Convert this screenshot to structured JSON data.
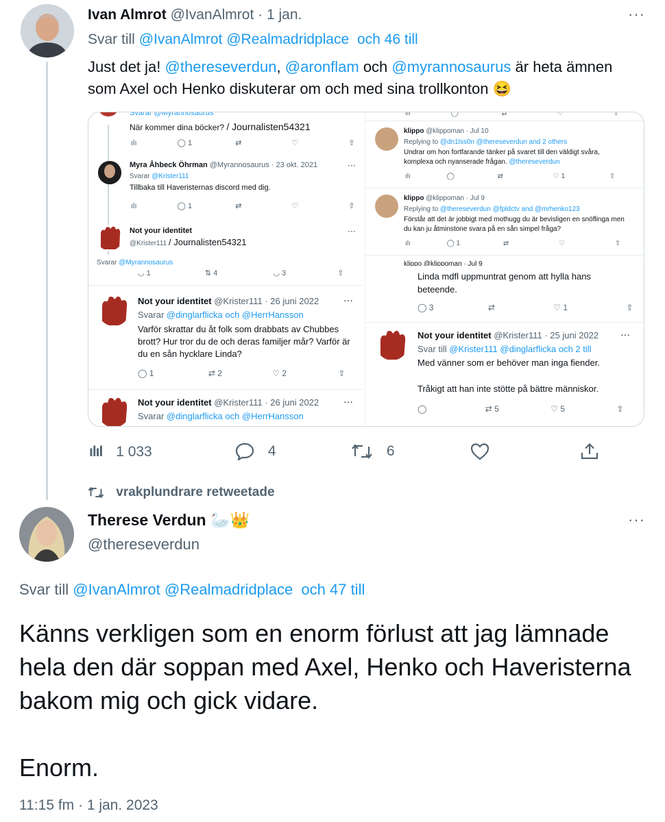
{
  "tweet1": {
    "name": "Ivan Almrot",
    "handle": "@IvanAlmrot",
    "dot": "·",
    "date": "1 jan.",
    "more": "···",
    "reply_prefix": "Svar till",
    "reply_to_1": "@IvanAlmrot",
    "reply_to_2": "@Realmadridplace",
    "reply_more": "och 46 till",
    "text_1": "Just det ja!",
    "mention_1": "@thereseverdun",
    "text_2": ",",
    "mention_2": "@aronflam",
    "text_3": "och",
    "mention_3": "@myrannosaurus",
    "text_4": "är heta ämnen som Axel och Henko diskuterar om och med sina trollkonton",
    "emoji": "😆",
    "stats": {
      "views": "1 033",
      "replies": "4",
      "retweets": "6"
    }
  },
  "embedded": {
    "left": {
      "top_reply": "Svarar @Myrannosaurus",
      "q1_text": "När kommer dina böcker?",
      "q1_tag": "/ Journalisten54321",
      "q1_reply_count": "1",
      "myra_name": "Myra Åhbeck Öhrman",
      "myra_handle": "@Myrannosaurus · 23 okt. 2021",
      "myra_reply_prefix": "Svarar",
      "myra_reply_to": "@Krister111",
      "myra_text": "Tillbaka till Haveristernas discord med dig.",
      "myra_reply_count": "1",
      "nyi_name": "Not your identitet",
      "nyi_handle": "@Krister111",
      "nyi_tag": "/ Journalisten54321",
      "svarar_label": "Svarar",
      "svarar_to": "@Myrannosaurus",
      "row_counts": [
        "1",
        "4",
        "3"
      ],
      "t2_name": "Not your identitet",
      "t2_meta": "@Krister111 · 26 juni 2022",
      "t2_reply_prefix": "Svarar",
      "t2_reply_to": "@dinglarflicka och @HerrHansson",
      "t2_text": "Varför skrattar du åt folk som drabbats av Chubbes brott? Hur tror du de och deras familjer mår? Varför är du en sån hycklare Linda?",
      "t2_counts": [
        "1",
        "2",
        "2"
      ],
      "t3_name": "Not your identitet",
      "t3_meta": "@Krister111 · 26 juni 2022",
      "t3_reply_prefix": "Svarar",
      "t3_reply_to": "@dinglarflicka och @HerrHansson"
    },
    "right": {
      "k1_name": "klippo",
      "k1_meta": "@klippoman · Jul 10",
      "k1_reply": "Replying to",
      "k1_reply_to": "@dn1lss0n @thereseverdun and 2 others",
      "k1_text_1": "Undrar om hon fortfarande tänker på svaret till den väldigt svåra,",
      "k1_text_2": "komplexa och nyanserade frågan.",
      "k1_mention": "@thereseverdun",
      "k1_like": "1",
      "k2_name": "klippo",
      "k2_meta": "@klippoman · Jul 9",
      "k2_reply": "Replying to",
      "k2_reply_to": "@thereseverdun @fpldctv and @mrhenko123",
      "k2_text_1": "Förstår att det är jobbigt med mothugg du är bevisligen en snöflinga men",
      "k2_text_2": "du kan ju åtminstone svara på en sån simpel fråga?",
      "k2_reply_count": "1",
      "k3_partial": "klippo @klippoman · Jul 9",
      "linda_text": "Linda mdfl uppmuntrat genom att hylla hans beteende.",
      "linda_counts": [
        "3",
        "1"
      ],
      "nyi_name": "Not your identitet",
      "nyi_meta": "@Krister111 · 25 juni 2022",
      "nyi_reply_prefix": "Svar till",
      "nyi_reply_to": "@Krister111 @dinglarflicka",
      "nyi_reply_more": "och 2 till",
      "nyi_text_1": "Med vänner som er behöver man inga fiender.",
      "nyi_text_2": "Tråkigt att han inte stötte på bättre människor.",
      "nyi_counts": [
        "5",
        "5"
      ]
    }
  },
  "retweet_label": "vrakplundrare retweetade",
  "tweet2": {
    "name": "Therese Verdun",
    "emoji": "🦢👑",
    "handle": "@thereseverdun",
    "more": "···",
    "reply_prefix": "Svar till",
    "reply_to_1": "@IvanAlmrot",
    "reply_to_2": "@Realmadridplace",
    "reply_more": "och 47 till",
    "text_1": "Känns verkligen som en enorm förlust att jag lämnade hela den där soppan med Axel, Henko och Haveristerna bakom mig och gick vidare.",
    "text_2": "Enorm.",
    "timestamp": "11:15 fm · 1 jan. 2023"
  },
  "colors": {
    "accent": "#1d9bf0",
    "muted": "#536471",
    "text": "#0f1419"
  }
}
